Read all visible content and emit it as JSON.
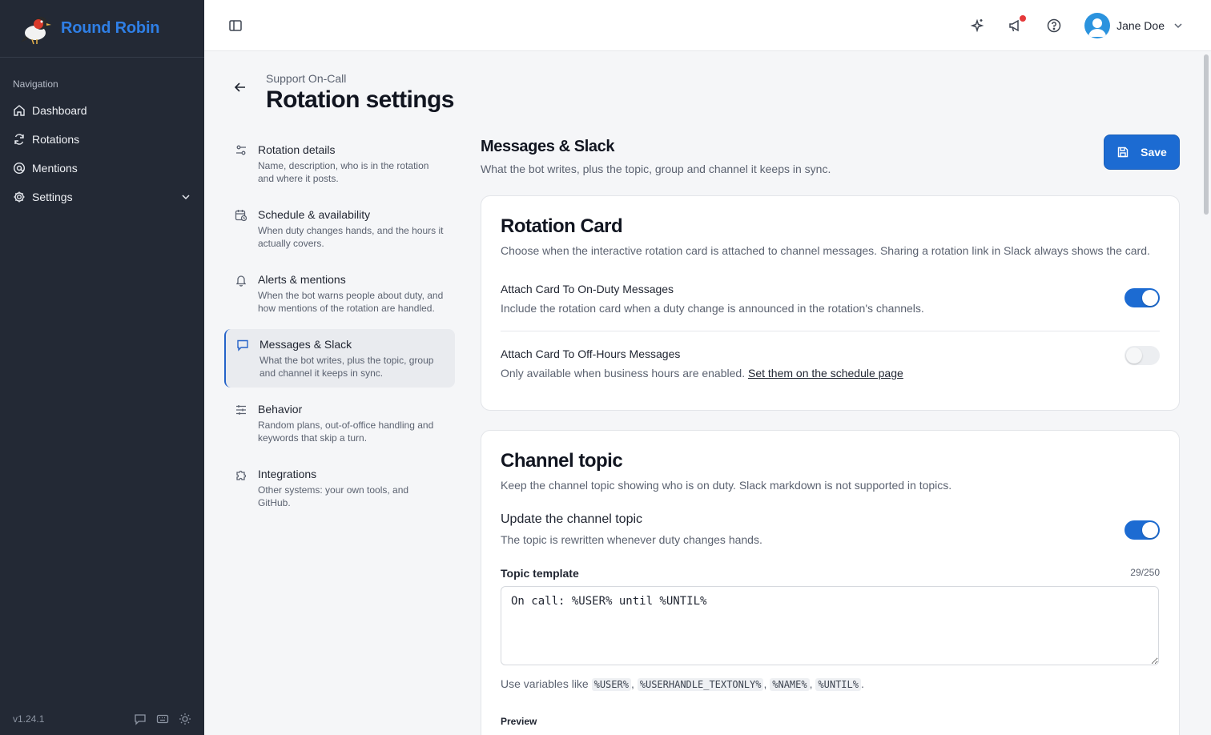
{
  "app": {
    "name": "Round Robin",
    "version": "v1.24.1"
  },
  "sidebar": {
    "heading": "Navigation",
    "items": [
      {
        "label": "Dashboard",
        "icon": "home-icon"
      },
      {
        "label": "Rotations",
        "icon": "refresh-icon"
      },
      {
        "label": "Mentions",
        "icon": "at-sign-icon"
      },
      {
        "label": "Settings",
        "icon": "gear-icon"
      }
    ]
  },
  "topbar": {
    "user_name": "Jane Doe"
  },
  "page": {
    "breadcrumb": "Support On-Call",
    "title": "Rotation settings"
  },
  "settings_nav": [
    {
      "title": "Rotation details",
      "desc": "Name, description, who is in the rotation and where it posts."
    },
    {
      "title": "Schedule & availability",
      "desc": "When duty changes hands, and the hours it actually covers."
    },
    {
      "title": "Alerts & mentions",
      "desc": "When the bot warns people about duty, and how mentions of the rotation are handled."
    },
    {
      "title": "Messages & Slack",
      "desc": "What the bot writes, plus the topic, group and channel it keeps in sync."
    },
    {
      "title": "Behavior",
      "desc": "Random plans, out-of-office handling and keywords that skip a turn."
    },
    {
      "title": "Integrations",
      "desc": "Other systems: your own tools, and GitHub."
    }
  ],
  "section": {
    "title": "Messages & Slack",
    "desc": "What the bot writes, plus the topic, group and channel it keeps in sync.",
    "save_label": "Save"
  },
  "rotation_card": {
    "title": "Rotation Card",
    "desc": "Choose when the interactive rotation card is attached to channel messages. Sharing a rotation link in Slack always shows the card.",
    "on_duty": {
      "title": "Attach Card To On-Duty Messages",
      "desc": "Include the rotation card when a duty change is announced in the rotation's channels.",
      "enabled": true
    },
    "off_hours": {
      "title": "Attach Card To Off-Hours Messages",
      "desc": "Only available when business hours are enabled.",
      "link": "Set them on the schedule page",
      "enabled": false
    }
  },
  "channel_topic": {
    "title": "Channel topic",
    "desc": "Keep the channel topic showing who is on duty. Slack markdown is not supported in topics.",
    "update": {
      "title": "Update the channel topic",
      "desc": "The topic is rewritten whenever duty changes hands.",
      "enabled": true
    },
    "template_label": "Topic template",
    "counter": "29/250",
    "template_value": "On call: %USER% until %UNTIL%",
    "hint_prefix": "Use variables like",
    "variables": [
      "%USER%",
      "%USERHANDLE_TEXTONLY%",
      "%NAME%",
      "%UNTIL%"
    ],
    "preview_label": "Preview"
  },
  "colors": {
    "accent": "#1c6bd2",
    "sidebar_bg": "#232935",
    "brand": "#2f7fe6",
    "notification": "#e5393a"
  }
}
